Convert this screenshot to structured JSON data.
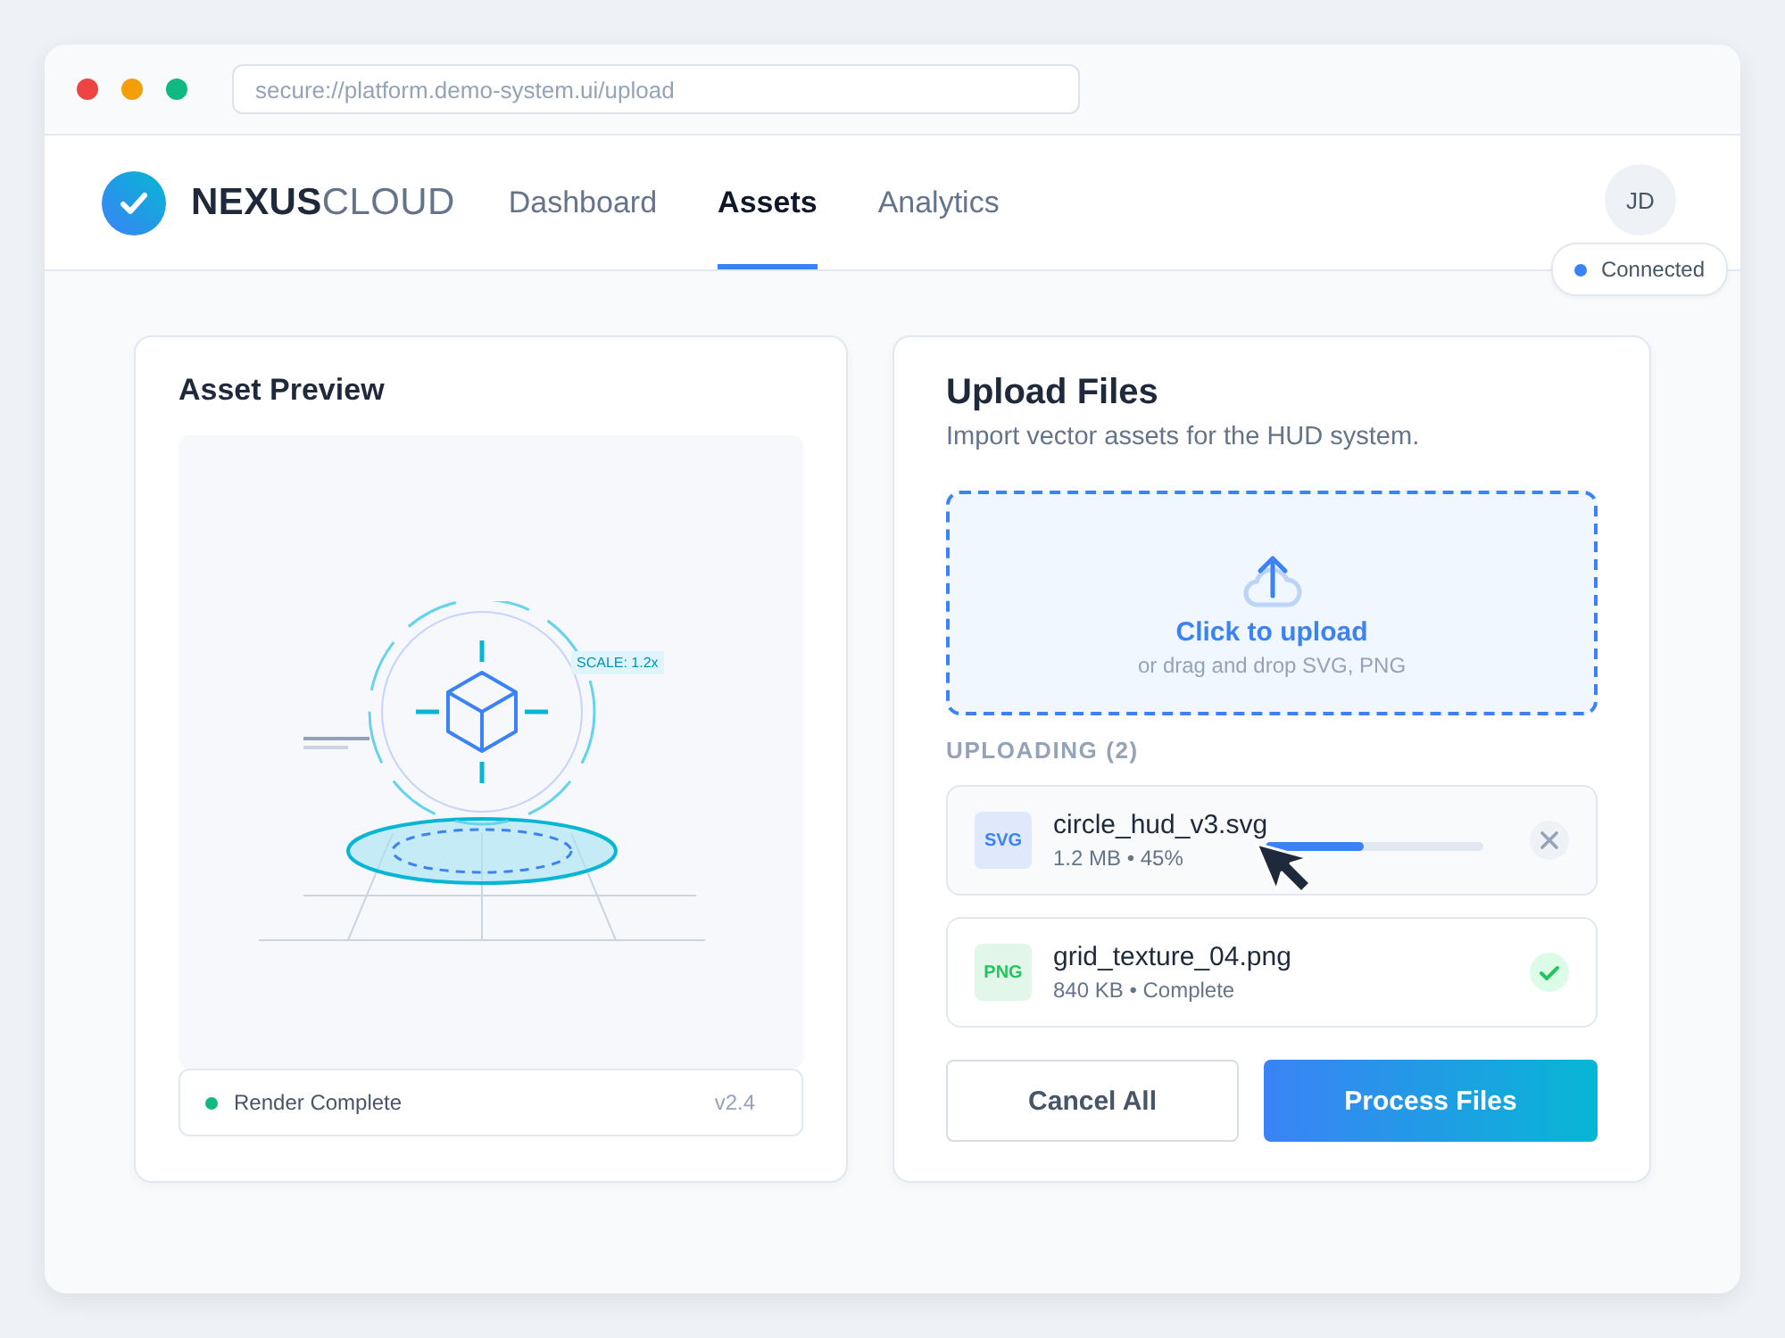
{
  "browser": {
    "url": "secure://platform.demo-system.ui/upload"
  },
  "nav": {
    "brand_bold": "NEXUS",
    "brand_light": "CLOUD",
    "tabs": [
      {
        "label": "Dashboard",
        "selected": false
      },
      {
        "label": "Assets",
        "selected": true
      },
      {
        "label": "Analytics",
        "selected": false
      }
    ],
    "avatar": "JD",
    "status": "Connected"
  },
  "preview": {
    "title": "Asset Preview",
    "scale_label": "SCALE: 1.2x",
    "status": "Render Complete",
    "version": "v2.4"
  },
  "upload": {
    "title": "Upload Files",
    "subtitle": "Import vector assets for the HUD system.",
    "drop_title": "Click to upload",
    "drop_hint": "or drag and drop SVG, PNG",
    "section": "UPLOADING (2)",
    "files": [
      {
        "kind": "uploading",
        "type": "SVG",
        "color": "#3b82f6",
        "name": "circle_hud_v3.svg",
        "meta": "1.2 MB • 45%",
        "level": 0.45
      },
      {
        "kind": "complete",
        "type": "PNG",
        "color": "#22c55e",
        "name": "grid_texture_04.png",
        "meta": "840 KB • Complete"
      }
    ],
    "buttons": {
      "cancel": "Cancel All",
      "process": "Process Files"
    }
  }
}
